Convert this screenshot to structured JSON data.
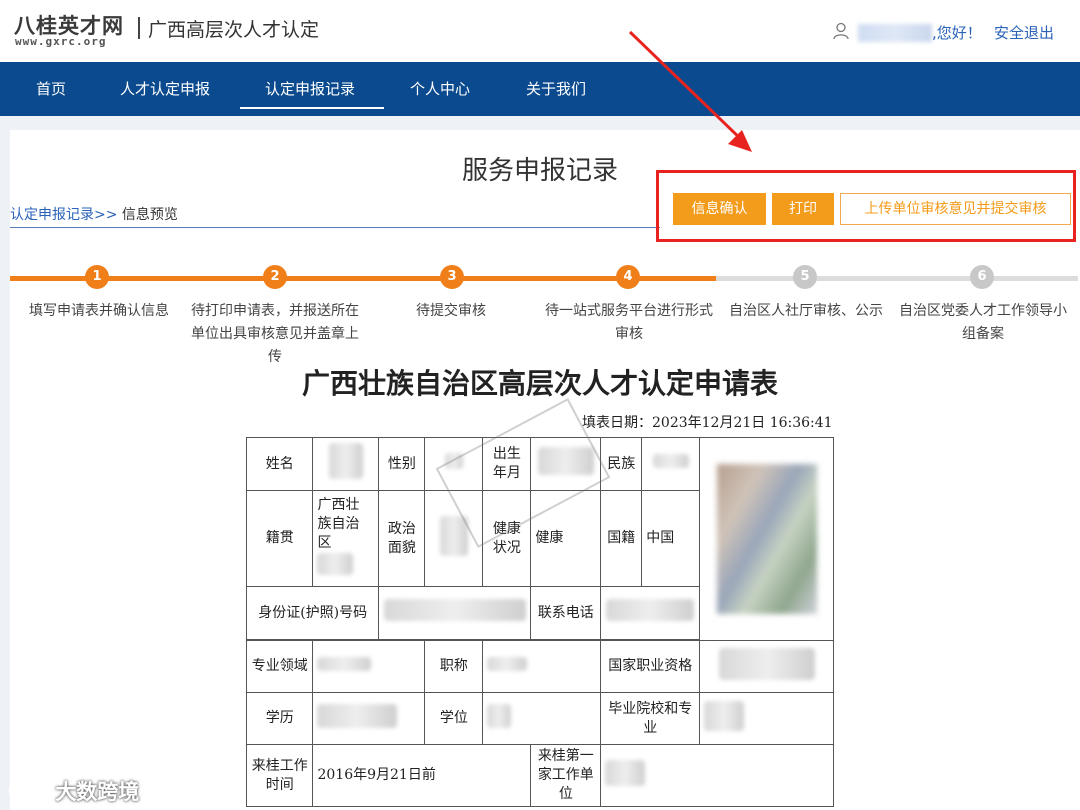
{
  "header": {
    "logo_cn": "八桂英才网",
    "logo_en": "www.gxrc.org",
    "site_title": "广西高层次人才认定",
    "greeting": ",您好！",
    "logout": "安全退出"
  },
  "nav": {
    "items": [
      {
        "label": "首页"
      },
      {
        "label": "人才认定申报"
      },
      {
        "label": "认定申报记录",
        "active": true
      },
      {
        "label": "个人中心"
      },
      {
        "label": "关于我们"
      }
    ]
  },
  "main": {
    "title": "服务申报记录",
    "breadcrumb": {
      "link": "认定申报记录",
      "sep": ">>",
      "current": "信息预览"
    },
    "actions": {
      "confirm": "信息确认",
      "print": "打印",
      "upload": "上传单位审核意见并提交审核"
    }
  },
  "steps": {
    "current": 4,
    "items": [
      {
        "num": "1",
        "label": "填写申请表并确认信息"
      },
      {
        "num": "2",
        "label": "待打印申请表，并报送所在单位出具审核意见并盖章上传"
      },
      {
        "num": "3",
        "label": "待提交审核"
      },
      {
        "num": "4",
        "label": "待一站式服务平台进行形式审核"
      },
      {
        "num": "5",
        "label": "自治区人社厅审核、公示"
      },
      {
        "num": "6",
        "label": "自治区党委人才工作领导小组备案"
      }
    ]
  },
  "form": {
    "title": "广西壮族自治区高层次人才认定申请表",
    "fill_date": "填表日期：2023年12月21日 16:36:41",
    "labels": {
      "name": "姓名",
      "gender": "性别",
      "birth": "出生年月",
      "ethnicity": "民族",
      "native_place": "籍贯",
      "political": "政治面貌",
      "health": "健康状况",
      "nationality": "国籍",
      "id_number": "身份证(护照)号码",
      "phone": "联系电话",
      "major": "专业领域",
      "title": "职称",
      "qualification": "国家职业资格",
      "education": "学历",
      "degree": "学位",
      "school": "毕业院校和专业",
      "work_time": "来桂工作时间",
      "first_employer": "来桂第一家工作单位"
    },
    "values": {
      "native_place": "广西壮族自治区",
      "health": "健康",
      "nationality": "中国",
      "work_time": "2016年9月21日前"
    }
  },
  "watermark": "大数跨境",
  "colors": {
    "nav": "#0b4a8e",
    "accent": "#f39b1a",
    "link": "#2a62b8",
    "highlight": "#e8231f"
  }
}
